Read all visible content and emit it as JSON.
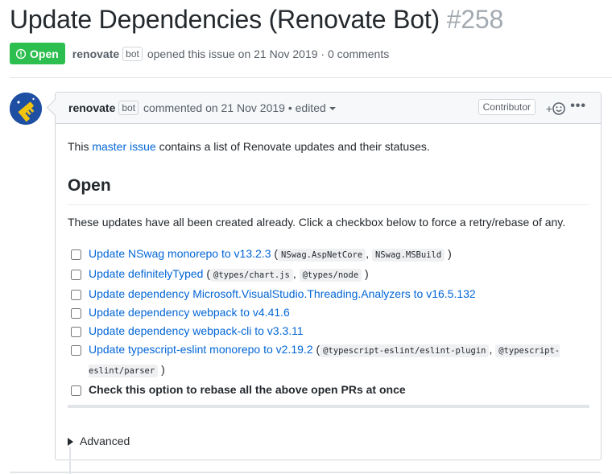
{
  "issue": {
    "title": "Update Dependencies (Renovate Bot)",
    "number": "#258",
    "state": "Open",
    "author": "renovate",
    "bot_label": "bot",
    "opened_text": "opened this issue on 21 Nov 2019 · 0 comments"
  },
  "comment": {
    "author": "renovate",
    "bot_label": "bot",
    "commented_text": "commented on 21 Nov 2019 •",
    "edited_text": "edited",
    "role_badge": "Contributor",
    "reaction_plus": "+",
    "more": "•••",
    "intro_prefix": "This ",
    "intro_link": "master issue",
    "intro_suffix": " contains a list of Renovate updates and their statuses.",
    "heading": "Open",
    "description": "These updates have all been created already. Click a checkbox below to force a retry/rebase of any.",
    "tasks": [
      {
        "link": "Update NSwag monorepo to v13.2.3",
        "open": " (",
        "codes": [
          "NSwag.AspNetCore",
          "NSwag.MSBuild"
        ],
        "close": ")"
      },
      {
        "link": "Update definitelyTyped",
        "open": " (",
        "codes": [
          "@types/chart.js",
          "@types/node"
        ],
        "close": ")"
      },
      {
        "link": "Update dependency Microsoft.VisualStudio.Threading.Analyzers to v16.5.132"
      },
      {
        "link": "Update dependency webpack to v4.41.6"
      },
      {
        "link": "Update dependency webpack-cli to v3.3.11"
      },
      {
        "link": "Update typescript-eslint monorepo to v2.19.2",
        "open": " (",
        "codes": [
          "@typescript-eslint/eslint-plugin",
          "@typescript-eslint/parser"
        ],
        "close": ")"
      }
    ],
    "rebase_all": "Check this option to rebase all the above open PRs at once",
    "advanced": "Advanced"
  },
  "colors": {
    "open_green": "#2cbe4e",
    "link_blue": "#0366d6",
    "avatar_blue": "#1e4fa3"
  }
}
